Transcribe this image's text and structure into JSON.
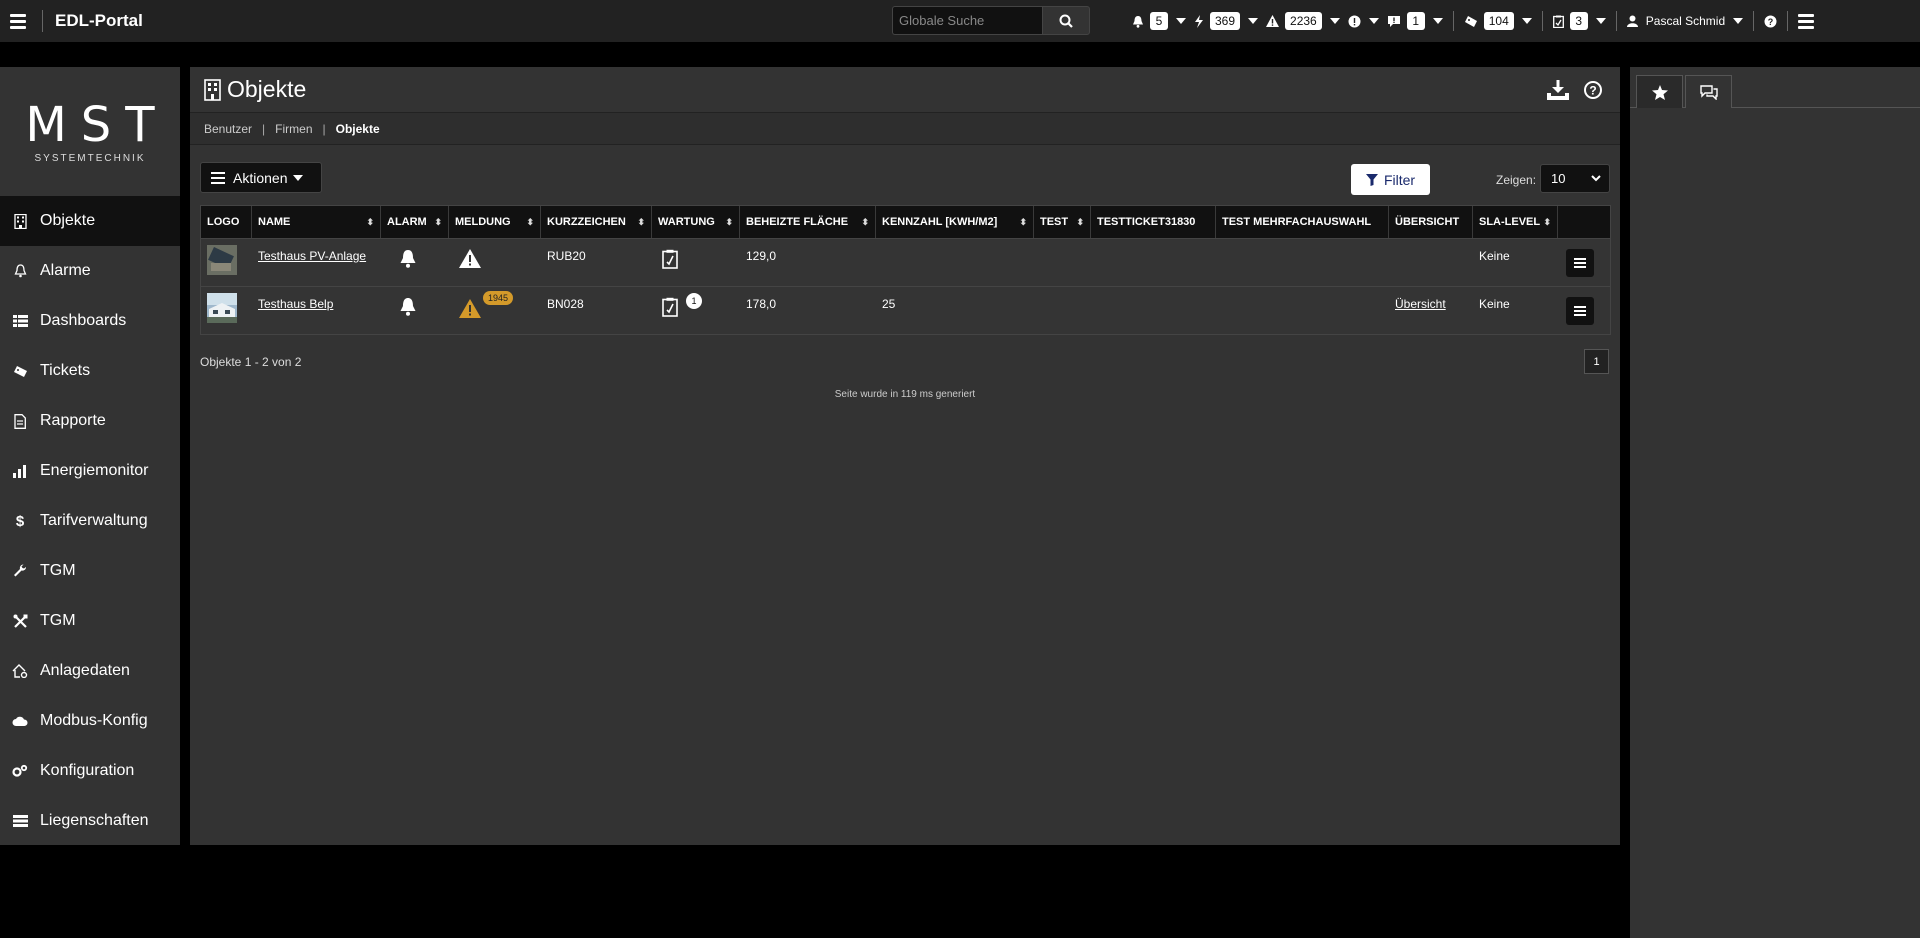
{
  "topbar": {
    "brand": "EDL-Portal",
    "search_placeholder": "Globale Suche",
    "indicators": [
      {
        "icon": "bell-icon",
        "count": "5"
      },
      {
        "icon": "bolt-icon",
        "count": "369"
      },
      {
        "icon": "warning-icon",
        "count": "2236"
      },
      {
        "icon": "exclamation-icon",
        "count": ""
      },
      {
        "icon": "comment-alert-icon",
        "count": "1"
      },
      {
        "icon": "ticket-icon",
        "count": "104"
      },
      {
        "icon": "clipboard-icon",
        "count": "3"
      }
    ],
    "user_name": "Pascal Schmid"
  },
  "logo": {
    "big": "MST",
    "small": "SYSTEMTECHNIK"
  },
  "sidebar": {
    "items": [
      {
        "label": "Objekte",
        "icon": "building-icon"
      },
      {
        "label": "Alarme",
        "icon": "bell-icon"
      },
      {
        "label": "Dashboards",
        "icon": "dashboard-icon"
      },
      {
        "label": "Tickets",
        "icon": "ticket-icon"
      },
      {
        "label": "Rapporte",
        "icon": "document-icon"
      },
      {
        "label": "Energiemonitor",
        "icon": "bar-chart-icon"
      },
      {
        "label": "Tarifverwaltung",
        "icon": "dollar-icon"
      },
      {
        "label": "TGM",
        "icon": "wrench-icon"
      },
      {
        "label": "TGM",
        "icon": "tools-icon"
      },
      {
        "label": "Anlagedaten",
        "icon": "house-gear-icon"
      },
      {
        "label": "Modbus-Konfig",
        "icon": "cloud-icon"
      },
      {
        "label": "Konfiguration",
        "icon": "gears-icon"
      },
      {
        "label": "Liegenschaften",
        "icon": "server-icon"
      }
    ]
  },
  "main": {
    "title": "Objekte",
    "breadcrumb": [
      "Benutzer",
      "Firmen",
      "Objekte"
    ],
    "actions_label": "Aktionen",
    "filter_label": "Filter",
    "zeigen_label": "Zeigen:",
    "zeigen_value": "10",
    "columns": [
      "LOGO",
      "NAME",
      "ALARM",
      "MELDUNG",
      "KURZZEICHEN",
      "WARTUNG",
      "BEHEIZTE FLÄCHE",
      "KENNZAHL [KWH/M2]",
      "TEST",
      "TESTTICKET31830",
      "TEST MEHRFACHAUSWAHL",
      "ÜBERSICHT",
      "SLA-LEVEL"
    ],
    "rows": [
      {
        "name": "Testhaus PV-Anlage",
        "meldung_count": "",
        "kurz": "RUB20",
        "wartung_count": "",
        "flaeche": "129,0",
        "kennzahl": "",
        "uebersicht": "",
        "sla": "Keine"
      },
      {
        "name": "Testhaus Belp",
        "meldung_count": "1945",
        "kurz": "BN028",
        "wartung_count": "1",
        "flaeche": "178,0",
        "kennzahl": "25",
        "uebersicht": "Übersicht",
        "sla": "Keine"
      }
    ],
    "pagination_info": "Objekte 1 - 2 von 2",
    "page": "1",
    "generated_info": "Seite wurde in 119 ms generiert"
  }
}
